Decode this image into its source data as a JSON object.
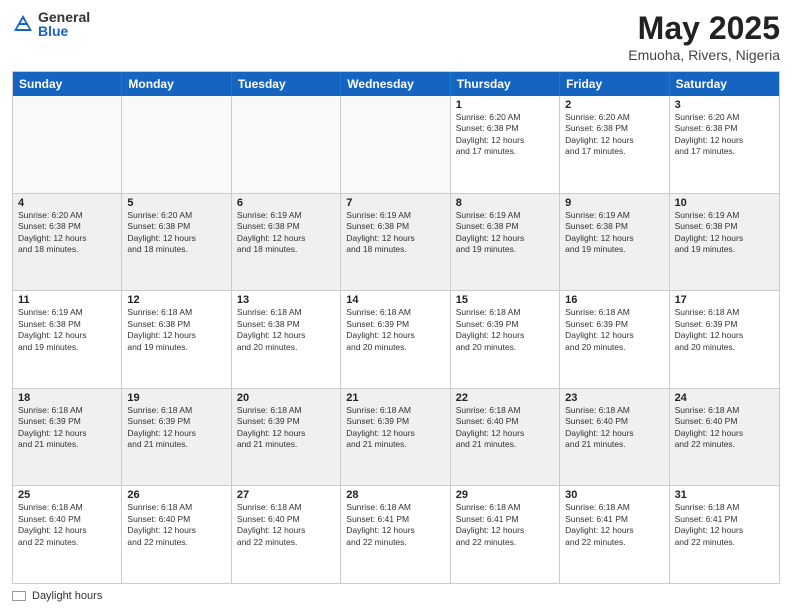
{
  "logo": {
    "general": "General",
    "blue": "Blue"
  },
  "title": "May 2025",
  "subtitle": "Emuoha, Rivers, Nigeria",
  "days_of_week": [
    "Sunday",
    "Monday",
    "Tuesday",
    "Wednesday",
    "Thursday",
    "Friday",
    "Saturday"
  ],
  "footer_label": "Daylight hours",
  "weeks": [
    [
      {
        "day": "",
        "info": ""
      },
      {
        "day": "",
        "info": ""
      },
      {
        "day": "",
        "info": ""
      },
      {
        "day": "",
        "info": ""
      },
      {
        "day": "1",
        "info": "Sunrise: 6:20 AM\nSunset: 6:38 PM\nDaylight: 12 hours\nand 17 minutes."
      },
      {
        "day": "2",
        "info": "Sunrise: 6:20 AM\nSunset: 6:38 PM\nDaylight: 12 hours\nand 17 minutes."
      },
      {
        "day": "3",
        "info": "Sunrise: 6:20 AM\nSunset: 6:38 PM\nDaylight: 12 hours\nand 17 minutes."
      }
    ],
    [
      {
        "day": "4",
        "info": "Sunrise: 6:20 AM\nSunset: 6:38 PM\nDaylight: 12 hours\nand 18 minutes."
      },
      {
        "day": "5",
        "info": "Sunrise: 6:20 AM\nSunset: 6:38 PM\nDaylight: 12 hours\nand 18 minutes."
      },
      {
        "day": "6",
        "info": "Sunrise: 6:19 AM\nSunset: 6:38 PM\nDaylight: 12 hours\nand 18 minutes."
      },
      {
        "day": "7",
        "info": "Sunrise: 6:19 AM\nSunset: 6:38 PM\nDaylight: 12 hours\nand 18 minutes."
      },
      {
        "day": "8",
        "info": "Sunrise: 6:19 AM\nSunset: 6:38 PM\nDaylight: 12 hours\nand 19 minutes."
      },
      {
        "day": "9",
        "info": "Sunrise: 6:19 AM\nSunset: 6:38 PM\nDaylight: 12 hours\nand 19 minutes."
      },
      {
        "day": "10",
        "info": "Sunrise: 6:19 AM\nSunset: 6:38 PM\nDaylight: 12 hours\nand 19 minutes."
      }
    ],
    [
      {
        "day": "11",
        "info": "Sunrise: 6:19 AM\nSunset: 6:38 PM\nDaylight: 12 hours\nand 19 minutes."
      },
      {
        "day": "12",
        "info": "Sunrise: 6:18 AM\nSunset: 6:38 PM\nDaylight: 12 hours\nand 19 minutes."
      },
      {
        "day": "13",
        "info": "Sunrise: 6:18 AM\nSunset: 6:38 PM\nDaylight: 12 hours\nand 20 minutes."
      },
      {
        "day": "14",
        "info": "Sunrise: 6:18 AM\nSunset: 6:39 PM\nDaylight: 12 hours\nand 20 minutes."
      },
      {
        "day": "15",
        "info": "Sunrise: 6:18 AM\nSunset: 6:39 PM\nDaylight: 12 hours\nand 20 minutes."
      },
      {
        "day": "16",
        "info": "Sunrise: 6:18 AM\nSunset: 6:39 PM\nDaylight: 12 hours\nand 20 minutes."
      },
      {
        "day": "17",
        "info": "Sunrise: 6:18 AM\nSunset: 6:39 PM\nDaylight: 12 hours\nand 20 minutes."
      }
    ],
    [
      {
        "day": "18",
        "info": "Sunrise: 6:18 AM\nSunset: 6:39 PM\nDaylight: 12 hours\nand 21 minutes."
      },
      {
        "day": "19",
        "info": "Sunrise: 6:18 AM\nSunset: 6:39 PM\nDaylight: 12 hours\nand 21 minutes."
      },
      {
        "day": "20",
        "info": "Sunrise: 6:18 AM\nSunset: 6:39 PM\nDaylight: 12 hours\nand 21 minutes."
      },
      {
        "day": "21",
        "info": "Sunrise: 6:18 AM\nSunset: 6:39 PM\nDaylight: 12 hours\nand 21 minutes."
      },
      {
        "day": "22",
        "info": "Sunrise: 6:18 AM\nSunset: 6:40 PM\nDaylight: 12 hours\nand 21 minutes."
      },
      {
        "day": "23",
        "info": "Sunrise: 6:18 AM\nSunset: 6:40 PM\nDaylight: 12 hours\nand 21 minutes."
      },
      {
        "day": "24",
        "info": "Sunrise: 6:18 AM\nSunset: 6:40 PM\nDaylight: 12 hours\nand 22 minutes."
      }
    ],
    [
      {
        "day": "25",
        "info": "Sunrise: 6:18 AM\nSunset: 6:40 PM\nDaylight: 12 hours\nand 22 minutes."
      },
      {
        "day": "26",
        "info": "Sunrise: 6:18 AM\nSunset: 6:40 PM\nDaylight: 12 hours\nand 22 minutes."
      },
      {
        "day": "27",
        "info": "Sunrise: 6:18 AM\nSunset: 6:40 PM\nDaylight: 12 hours\nand 22 minutes."
      },
      {
        "day": "28",
        "info": "Sunrise: 6:18 AM\nSunset: 6:41 PM\nDaylight: 12 hours\nand 22 minutes."
      },
      {
        "day": "29",
        "info": "Sunrise: 6:18 AM\nSunset: 6:41 PM\nDaylight: 12 hours\nand 22 minutes."
      },
      {
        "day": "30",
        "info": "Sunrise: 6:18 AM\nSunset: 6:41 PM\nDaylight: 12 hours\nand 22 minutes."
      },
      {
        "day": "31",
        "info": "Sunrise: 6:18 AM\nSunset: 6:41 PM\nDaylight: 12 hours\nand 22 minutes."
      }
    ]
  ]
}
